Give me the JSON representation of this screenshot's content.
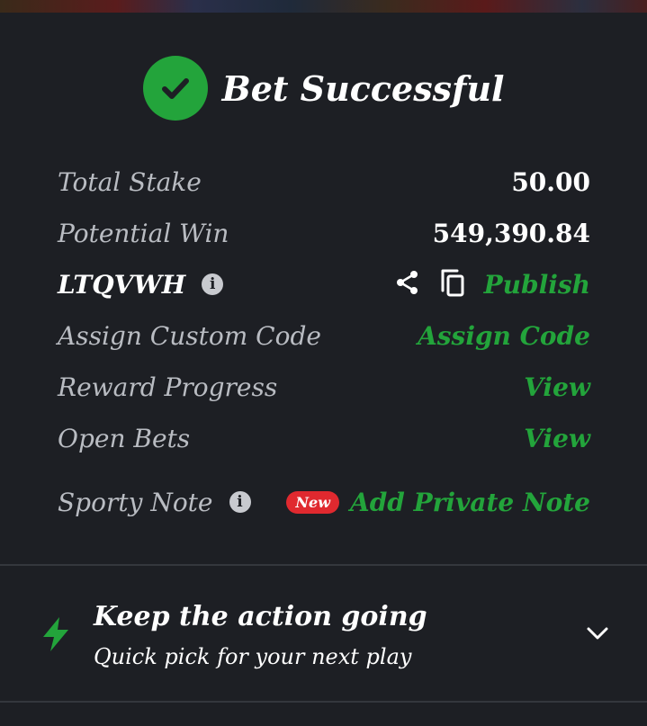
{
  "header": {
    "title": "Bet Successful"
  },
  "details": {
    "total_stake": {
      "label": "Total Stake",
      "value": "50.00"
    },
    "potential_win": {
      "label": "Potential Win",
      "value": "549,390.84"
    },
    "booking": {
      "code": "LTQVWH",
      "publish_label": "Publish"
    },
    "custom_code": {
      "label": "Assign Custom Code",
      "action": "Assign Code"
    },
    "reward_progress": {
      "label": "Reward Progress",
      "action": "View"
    },
    "open_bets": {
      "label": "Open Bets",
      "action": "View"
    },
    "sporty_note": {
      "label": "Sporty Note",
      "badge": "New",
      "action": "Add Private Note"
    }
  },
  "promo": {
    "title": "Keep the action going",
    "subtitle": "Quick pick for your next play"
  },
  "colors": {
    "accent": "#23a43b",
    "background": "#1d1f24",
    "badge": "#e0292f"
  },
  "icons": [
    "check-icon",
    "info-icon",
    "share-icon",
    "copy-icon",
    "lightning-icon",
    "chevron-down-icon"
  ]
}
